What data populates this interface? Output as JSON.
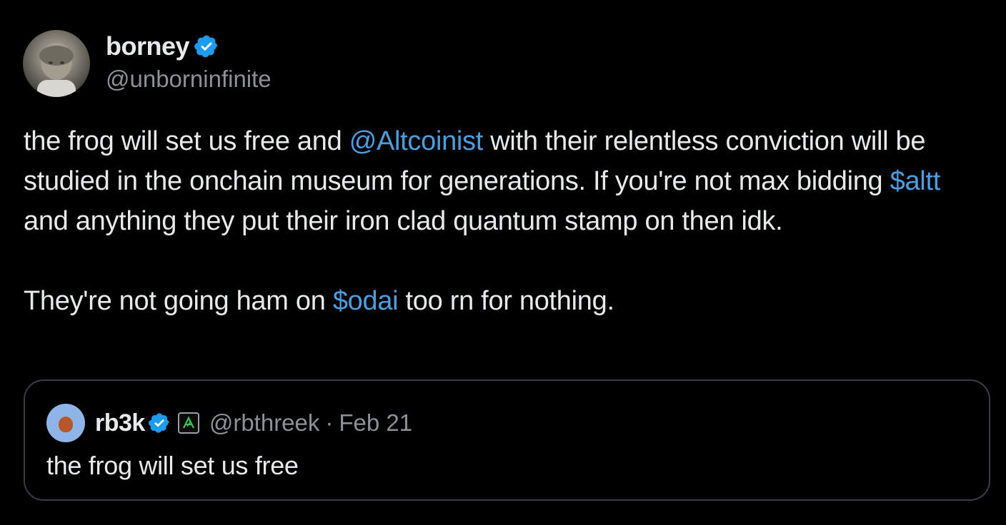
{
  "author": {
    "name": "borney",
    "handle": "@unborninfinite",
    "verified": true
  },
  "post": {
    "p1_part1": "the frog will set us free and ",
    "p1_mention": "@Altcoinist",
    "p1_part2": " with their relentless conviction will be studied in the onchain museum for generations. If you're not max bidding ",
    "p1_cashtag": "$altt",
    "p1_part3": " and anything they put their iron clad quantum stamp on then idk.",
    "p2_part1": "They're not going ham on ",
    "p2_cashtag": "$odai",
    "p2_part2": " too rn for nothing."
  },
  "quote": {
    "name": "rb3k",
    "handle": "@rbthreek",
    "separator": "·",
    "date": "Feb 21",
    "text": "the frog will set us free",
    "verified": true
  },
  "colors": {
    "background": "#000000",
    "text": "#e7e9ea",
    "secondary": "#8b9197",
    "link": "#4b9fe1",
    "verified": "#1d9bf0",
    "border": "#3a3e42"
  },
  "icons": {
    "verified": "verified-badge-icon",
    "affiliate": "affiliate-badge-icon"
  }
}
